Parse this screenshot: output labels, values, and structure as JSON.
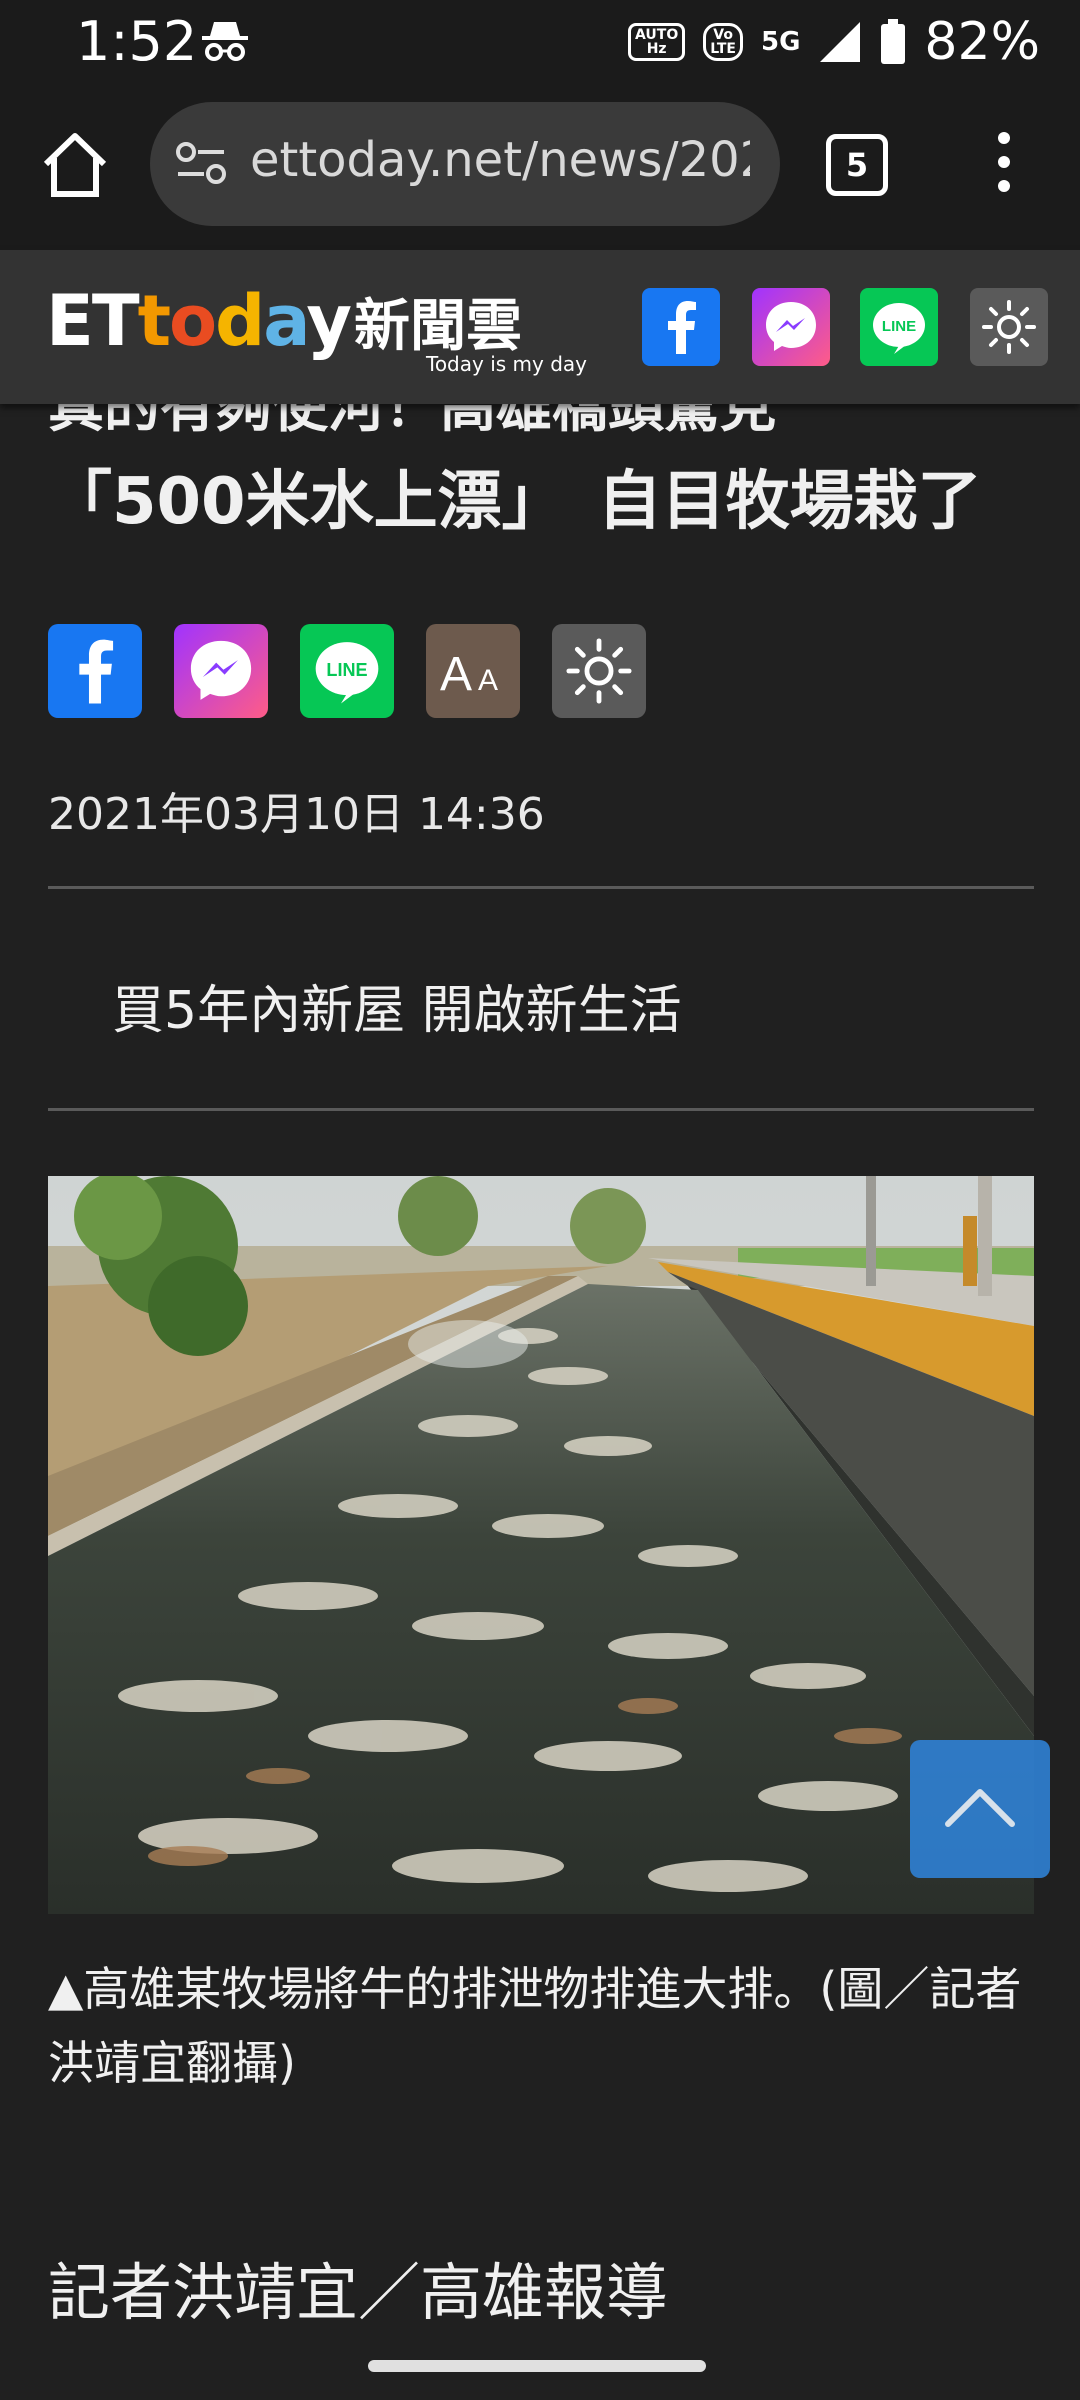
{
  "status_bar": {
    "time": "1:52",
    "icons": [
      "incognito-icon",
      "auto-hz-icon",
      "volte-icon",
      "5g-icon",
      "signal-icon",
      "battery-icon"
    ],
    "auto_label": "AUTO",
    "volte_label": "LTE",
    "network": "5G",
    "battery": "82%"
  },
  "browser": {
    "url": "ettoday.net/news/202",
    "tab_count": "5"
  },
  "site_header": {
    "logo_text": "ETtoday",
    "logo_cn": "新聞雲",
    "tagline": "Today is my day",
    "buttons": [
      "facebook-icon",
      "messenger-icon",
      "line-icon",
      "brightness-icon"
    ],
    "line_label": "LINE"
  },
  "article": {
    "title_line_cut": "真的有夠使河！高雄橋頭驚見",
    "title_line2": "「500米水上漂」　自目牧場栽了",
    "share_buttons": [
      "facebook-icon",
      "messenger-icon",
      "line-icon",
      "font-size-icon",
      "brightness-icon"
    ],
    "font_label_big": "A",
    "font_label_small": "A",
    "date": "2021年03月10日 14:36",
    "ad_text": "買5年內新屋 開啟新生活",
    "caption": "▲高雄某牧場將牛的排泄物排進大排。(圖／記者洪靖宜翻攝)",
    "byline": "記者洪靖宜／高雄報導"
  },
  "colors": {
    "background": "#202020",
    "facebook": "#1877f2",
    "line": "#06c755",
    "messenger_start": "#a033ff",
    "messenger_end": "#ff5c87",
    "font_btn": "#6d5a4d",
    "brightness_btn": "#5a5a5a",
    "scroll_top": "#2f7fd0"
  }
}
